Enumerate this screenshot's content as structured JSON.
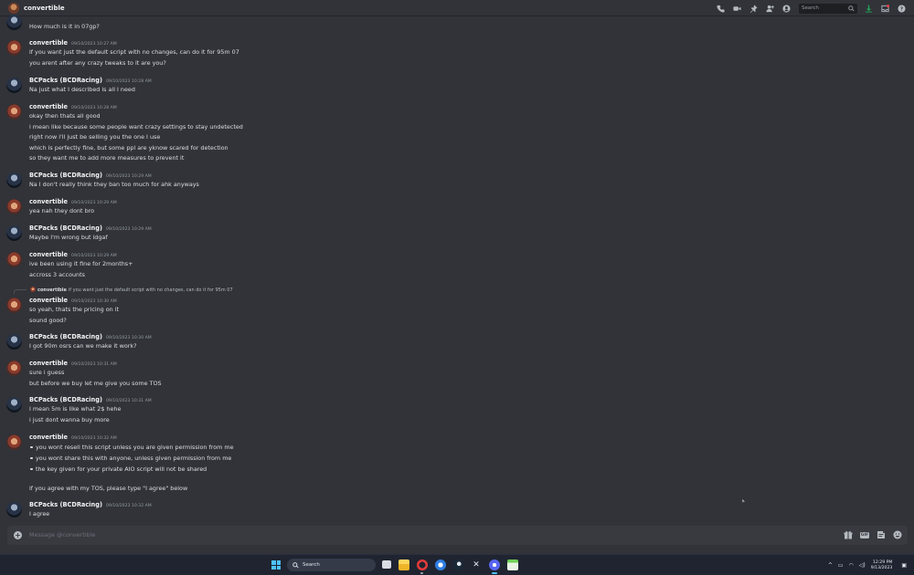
{
  "header": {
    "title": "convertible",
    "search_placeholder": "Search",
    "icons": [
      "voice-call-icon",
      "video-call-icon",
      "pinned-icon",
      "add-friends-icon",
      "user-profile-icon",
      "search-icon",
      "download-icon",
      "inbox-icon",
      "help-icon"
    ]
  },
  "messages": [
    {
      "type": "continuation",
      "lines": [
        "How much is it in 07gp?"
      ],
      "author": "BCPacks (BCDRacing)",
      "avatar": "bcp"
    },
    {
      "type": "group",
      "author": "convertible",
      "avatar": "conv",
      "timestamp": "09/10/2023 10:27 AM",
      "lines": [
        "if you want just the default script with no changes, can do it for 95m 07",
        "you arent after any crazy tweaks to it are you?"
      ]
    },
    {
      "type": "group",
      "author": "BCPacks (BCDRacing)",
      "avatar": "bcp",
      "timestamp": "09/10/2023 10:28 AM",
      "lines": [
        "Na just what I described is all I need"
      ]
    },
    {
      "type": "group",
      "author": "convertible",
      "avatar": "conv",
      "timestamp": "09/10/2023 10:28 AM",
      "lines": [
        "okay then thats all good",
        "i mean like because some people want crazy settings to stay undetected",
        "right now i'll just be selling you the one I use",
        "which is perfectly fine, but some ppl are yknow scared for detection",
        "so they want me to add more measures to prevent it"
      ]
    },
    {
      "type": "group",
      "author": "BCPacks (BCDRacing)",
      "avatar": "bcp",
      "timestamp": "09/10/2023 10:29 AM",
      "lines": [
        "Na I don't really think they ban too much for ahk anyways"
      ]
    },
    {
      "type": "group",
      "author": "convertible",
      "avatar": "conv",
      "timestamp": "09/10/2023 10:29 AM",
      "lines": [
        "yea nah they dont bro"
      ]
    },
    {
      "type": "group",
      "author": "BCPacks (BCDRacing)",
      "avatar": "bcp",
      "timestamp": "09/10/2023 10:29 AM",
      "lines": [
        "Maybe I'm wrong but idgaf"
      ]
    },
    {
      "type": "group",
      "author": "convertible",
      "avatar": "conv",
      "timestamp": "09/10/2023 10:29 AM",
      "lines": [
        "ive been using it fine for 2months+",
        "accross 3 accounts"
      ]
    },
    {
      "type": "group",
      "author": "convertible",
      "avatar": "conv",
      "timestamp": "09/10/2023 10:30 AM",
      "reply": {
        "author": "convertible",
        "text": "if you want just the default script with no changes, can do it for 95m 07"
      },
      "lines": [
        "so yeah, thats the pricing on it",
        "sound good?"
      ]
    },
    {
      "type": "group",
      "author": "BCPacks (BCDRacing)",
      "avatar": "bcp",
      "timestamp": "09/10/2023 10:30 AM",
      "lines": [
        "I got 90m osrs can we make it work?"
      ]
    },
    {
      "type": "group",
      "author": "convertible",
      "avatar": "conv",
      "timestamp": "09/10/2023 10:31 AM",
      "lines": [
        "sure i guess",
        "but before we buy let me give you some TOS"
      ]
    },
    {
      "type": "group",
      "author": "BCPacks (BCDRacing)",
      "avatar": "bcp",
      "timestamp": "09/10/2023 10:31 AM",
      "lines": [
        "I mean 5m is like what 2$ hehe",
        "i just dont wanna buy more"
      ]
    },
    {
      "type": "group",
      "author": "convertible",
      "avatar": "conv",
      "timestamp": "09/10/2023 10:32 AM",
      "bullets": [
        "you wont resell this script unless you are given permission from me",
        "you wont share this with anyone, unless given permission from me",
        "the key given for your private AIO script will not be shared"
      ],
      "lines_after": [
        "if you agree with my TOS, please type \"I agree\" below"
      ]
    },
    {
      "type": "group",
      "author": "BCPacks (BCDRacing)",
      "avatar": "bcp",
      "timestamp": "09/10/2023 10:32 AM",
      "lines": [
        "I agree"
      ]
    }
  ],
  "composer": {
    "placeholder": "Message @convertible",
    "icons": [
      "add-icon",
      "gift-icon",
      "gif-button",
      "sticker-icon",
      "emoji-icon"
    ],
    "gif_label": "GIF"
  },
  "taskbar": {
    "search_label": "Search",
    "time": "12:29 PM",
    "date": "9/13/2023"
  },
  "colors": {
    "background": "#313338",
    "header": "#313338",
    "composer": "#383a40",
    "taskbar": "#1f2430",
    "accent": "#4cc2ff"
  }
}
